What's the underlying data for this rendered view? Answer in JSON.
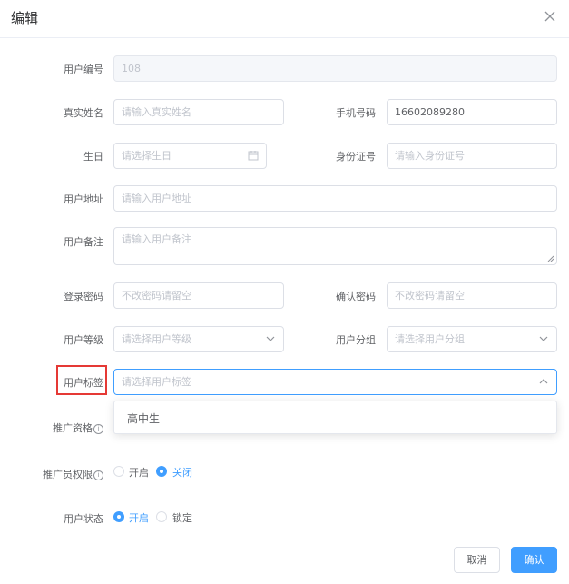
{
  "dialog": {
    "title": "编辑"
  },
  "form": {
    "user_id": {
      "label": "用户编号",
      "value": "108"
    },
    "real_name": {
      "label": "真实姓名",
      "placeholder": "请输入真实姓名"
    },
    "phone": {
      "label": "手机号码",
      "value": "16602089280"
    },
    "birthday": {
      "label": "生日",
      "placeholder": "请选择生日"
    },
    "id_card": {
      "label": "身份证号",
      "placeholder": "请输入身份证号"
    },
    "address": {
      "label": "用户地址",
      "placeholder": "请输入用户地址"
    },
    "remark": {
      "label": "用户备注",
      "placeholder": "请输入用户备注"
    },
    "password": {
      "label": "登录密码",
      "placeholder": "不改密码请留空"
    },
    "confirm_password": {
      "label": "确认密码",
      "placeholder": "不改密码请留空"
    },
    "level": {
      "label": "用户等级",
      "placeholder": "请选择用户等级"
    },
    "group": {
      "label": "用户分组",
      "placeholder": "请选择用户分组"
    },
    "tags": {
      "label": "用户标签",
      "placeholder": "请选择用户标签",
      "options": [
        "高中生"
      ]
    },
    "promo_qualification": {
      "label": "推广资格"
    },
    "promoter_permission": {
      "label": "推广员权限",
      "options": [
        "开启",
        "关闭"
      ],
      "selected": "关闭"
    },
    "status": {
      "label": "用户状态",
      "options": [
        "开启",
        "锁定"
      ],
      "selected": "开启"
    }
  },
  "footer": {
    "cancel_label": "取消",
    "confirm_label": "确认"
  },
  "colors": {
    "primary": "#409eff",
    "highlight_border": "#e53935"
  }
}
